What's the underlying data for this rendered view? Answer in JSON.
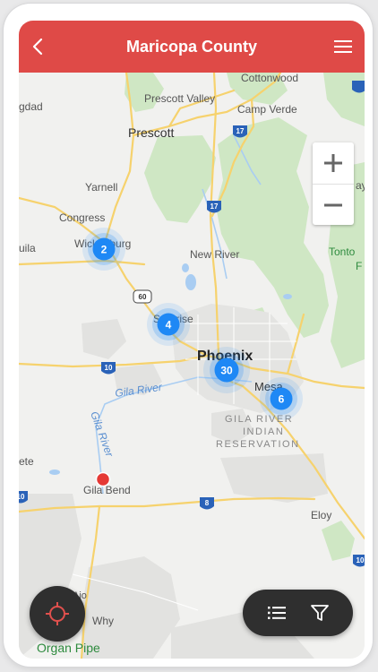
{
  "header": {
    "title": "Maricopa County",
    "color": "#df4a47"
  },
  "icons": {
    "back": "chevron-left-icon",
    "menu": "hamburger-menu-icon",
    "locate": "crosshair-icon",
    "list": "list-icon",
    "filter": "funnel-icon"
  },
  "zoom": {
    "in_label": "+",
    "out_label": "−"
  },
  "map": {
    "place_labels": {
      "cottonwood": "Cottonwood",
      "prescott_valley": "Prescott Valley",
      "prescott": "Prescott",
      "camp_verde": "Camp Verde",
      "yarnell": "Yarnell",
      "congress": "Congress",
      "wickenburg": "Wickenburg",
      "aguila": "uila",
      "new_river": "New River",
      "surprise": "Surprise",
      "phoenix": "Phoenix",
      "mesa": "Mesa",
      "gila_river_indian_1": "GILA RIVER",
      "gila_river_indian_2": "INDIAN",
      "gila_river_indian_3": "RESERVATION",
      "gila_river_h": "Gila River",
      "gila_river_v": "Gila River",
      "gila_bend": "Gila Bend",
      "eloy": "Eloy",
      "ajo": "Ajo",
      "why": "Why",
      "organ_pipe": "Organ Pipe",
      "tonto_1": "Tonto",
      "tonto_2": "F",
      "gdad": "gdad",
      "ete": "ete",
      "pay": "ay"
    },
    "shields": {
      "i17_a": "17",
      "i17_b": "17",
      "us60": "60",
      "i10_a": "10",
      "i10_b": "10",
      "i8": "8",
      "i10_c": "10",
      "i10_d": "10"
    },
    "clusters": [
      {
        "id": "wickenburg",
        "count": "2"
      },
      {
        "id": "surprise",
        "count": "4"
      },
      {
        "id": "phoenix",
        "count": "30"
      },
      {
        "id": "mesa",
        "count": "6"
      }
    ],
    "cluster_color": "#1e88f5",
    "marker_color": "#e53935"
  }
}
